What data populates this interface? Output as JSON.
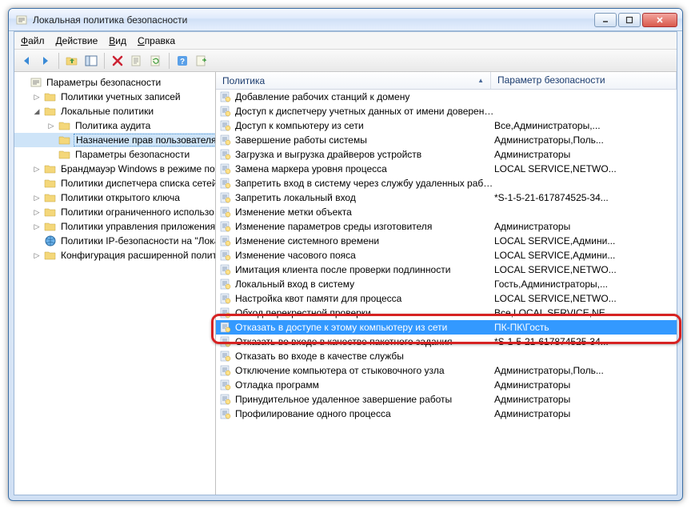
{
  "window": {
    "title": "Локальная политика безопасности"
  },
  "menu": {
    "file": "Файл",
    "action": "Действие",
    "view": "Вид",
    "help": "Справка"
  },
  "tree": {
    "root": "Параметры безопасности",
    "items": [
      {
        "label": "Политики учетных записей",
        "depth": 1,
        "expander": "▷",
        "icon": "folder"
      },
      {
        "label": "Локальные политики",
        "depth": 1,
        "expander": "◢",
        "icon": "folder"
      },
      {
        "label": "Политика аудита",
        "depth": 2,
        "expander": "▷",
        "icon": "folder"
      },
      {
        "label": "Назначение прав пользователя",
        "depth": 2,
        "expander": "",
        "icon": "folder",
        "selected": true
      },
      {
        "label": "Параметры безопасности",
        "depth": 2,
        "expander": "",
        "icon": "folder"
      },
      {
        "label": "Брандмауэр Windows в режиме пов",
        "depth": 1,
        "expander": "▷",
        "icon": "folder"
      },
      {
        "label": "Политики диспетчера списка сетей",
        "depth": 1,
        "expander": "",
        "icon": "folder"
      },
      {
        "label": "Политики открытого ключа",
        "depth": 1,
        "expander": "▷",
        "icon": "folder"
      },
      {
        "label": "Политики ограниченного использо",
        "depth": 1,
        "expander": "▷",
        "icon": "folder"
      },
      {
        "label": "Политики управления приложения",
        "depth": 1,
        "expander": "▷",
        "icon": "folder"
      },
      {
        "label": "Политики IP-безопасности на \"Лока",
        "depth": 1,
        "expander": "",
        "icon": "ipsec"
      },
      {
        "label": "Конфигурация расширенной полит",
        "depth": 1,
        "expander": "▷",
        "icon": "folder"
      }
    ]
  },
  "list": {
    "col_policy": "Политика",
    "col_param": "Параметр безопасности",
    "rows": [
      {
        "policy": "Добавление рабочих станций к домену",
        "param": ""
      },
      {
        "policy": "Доступ к диспетчеру учетных данных от имени доверенн...",
        "param": ""
      },
      {
        "policy": "Доступ к компьютеру из сети",
        "param": "Все,Администраторы,..."
      },
      {
        "policy": "Завершение работы системы",
        "param": "Администраторы,Поль..."
      },
      {
        "policy": "Загрузка и выгрузка драйверов устройств",
        "param": "Администраторы"
      },
      {
        "policy": "Замена маркера уровня процесса",
        "param": "LOCAL SERVICE,NETWO..."
      },
      {
        "policy": "Запретить вход в систему через службу удаленных рабоч...",
        "param": ""
      },
      {
        "policy": "Запретить локальный вход",
        "param": "*S-1-5-21-617874525-34..."
      },
      {
        "policy": "Изменение метки объекта",
        "param": ""
      },
      {
        "policy": "Изменение параметров среды изготовителя",
        "param": "Администраторы"
      },
      {
        "policy": "Изменение системного времени",
        "param": "LOCAL SERVICE,Админи..."
      },
      {
        "policy": "Изменение часового пояса",
        "param": "LOCAL SERVICE,Админи..."
      },
      {
        "policy": "Имитация клиента после проверки подлинности",
        "param": "LOCAL SERVICE,NETWO..."
      },
      {
        "policy": "Локальный вход в систему",
        "param": "Гость,Администраторы,..."
      },
      {
        "policy": "Настройка квот памяти для процесса",
        "param": "LOCAL SERVICE,NETWO..."
      },
      {
        "policy": "Обход перекрестной проверки",
        "param": "Все,LOCAL SERVICE,NE..."
      },
      {
        "policy": "Отказать в доступе к этому компьютеру из сети",
        "param": "ПК-ПК\\Гость",
        "selected": true
      },
      {
        "policy": "Отказать во входе в качестве пакетного задания",
        "param": "*S-1-5-21-617874525-34..."
      },
      {
        "policy": "Отказать во входе в качестве службы",
        "param": ""
      },
      {
        "policy": "Отключение компьютера от стыковочного узла",
        "param": "Администраторы,Поль..."
      },
      {
        "policy": "Отладка программ",
        "param": "Администраторы"
      },
      {
        "policy": "Принудительное удаленное завершение работы",
        "param": "Администраторы"
      },
      {
        "policy": "Профилирование одного процесса",
        "param": "Администраторы"
      }
    ]
  },
  "toolbar_icons": [
    "back",
    "forward",
    "up",
    "show-hide-tree",
    "delete",
    "properties",
    "refresh",
    "help",
    "export"
  ]
}
